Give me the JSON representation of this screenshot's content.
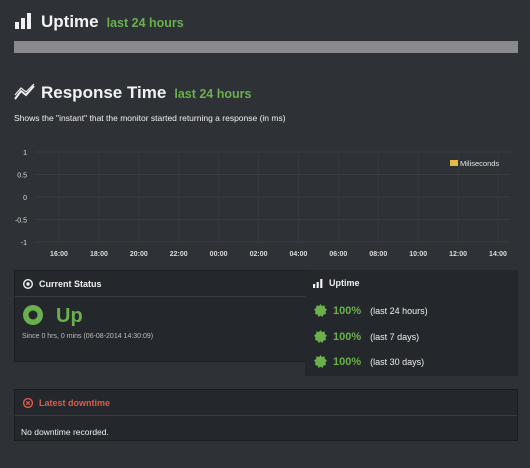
{
  "uptime_section": {
    "title": "Uptime",
    "subtitle": "last 24 hours",
    "uptime_ratio": 1.0,
    "bar_color": "#8a8a8a",
    "icon": "bar-chart-icon"
  },
  "response_section": {
    "title": "Response Time",
    "subtitle": "last 24 hours",
    "description": "Shows the \"instant\" that the monitor started returning a response (in ms)",
    "icon": "line-chart-icon"
  },
  "chart_data": {
    "type": "line",
    "x": [
      "16:00",
      "18:00",
      "20:00",
      "22:00",
      "00:00",
      "02:00",
      "04:00",
      "06:00",
      "08:00",
      "10:00",
      "12:00",
      "14:00"
    ],
    "series": [
      {
        "name": "Miliseconds",
        "values": [],
        "color": "#e6b846"
      }
    ],
    "y_ticks": [
      "1",
      "0.5",
      "0",
      "-0.5",
      "-1"
    ],
    "ylim": [
      -1,
      1
    ],
    "grid": true,
    "legend_position": "top-right",
    "title": "",
    "xlabel": "",
    "ylabel": ""
  },
  "current_status": {
    "title": "Current Status",
    "status": "Up",
    "since": "Since 0 hrs, 0 mins (06-08-2014 14:30:09)",
    "icon": "target-icon"
  },
  "uptime_panel": {
    "title": "Uptime",
    "icon": "bar-chart-icon",
    "rows": [
      {
        "value": "100%",
        "period": "(last 24 hours)"
      },
      {
        "value": "100%",
        "period": "(last 7 days)"
      },
      {
        "value": "100%",
        "period": "(last 30 days)"
      }
    ]
  },
  "downtime": {
    "title": "Latest downtime",
    "message": "No downtime recorded.",
    "icon": "close-circle-icon"
  },
  "colors": {
    "accent_green": "#6ab04c",
    "danger": "#e05b4b",
    "legend": "#e6b846"
  }
}
